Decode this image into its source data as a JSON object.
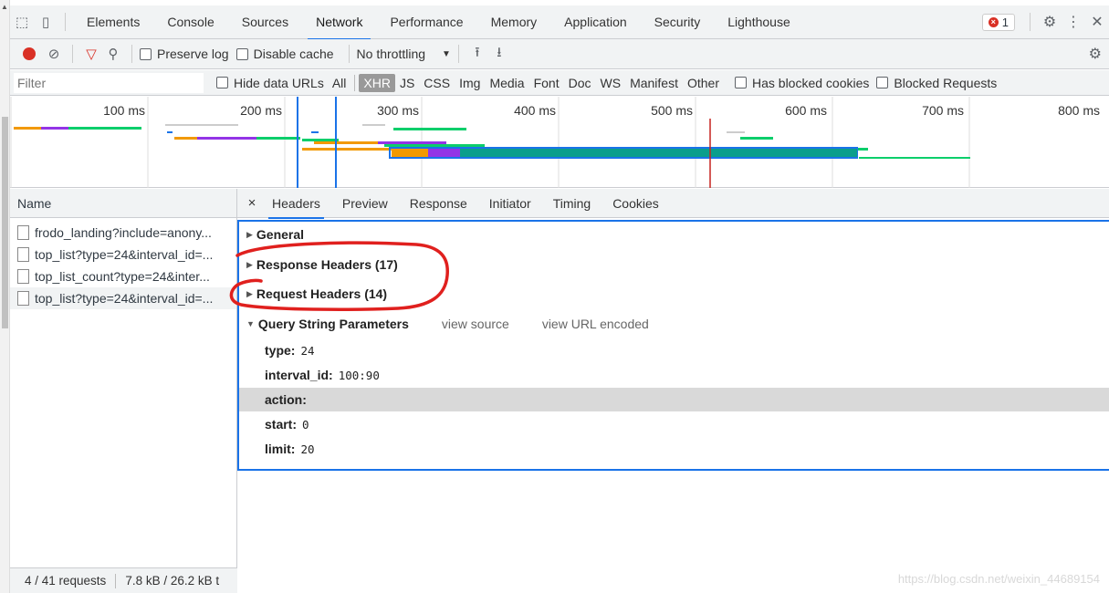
{
  "tabs": {
    "items": [
      "Elements",
      "Console",
      "Sources",
      "Network",
      "Performance",
      "Memory",
      "Application",
      "Security",
      "Lighthouse"
    ],
    "active": "Network",
    "error_count": "1"
  },
  "toolbar": {
    "preserve_log": "Preserve log",
    "disable_cache": "Disable cache",
    "throttling": "No throttling"
  },
  "filter": {
    "placeholder": "Filter",
    "hide_data_urls": "Hide data URLs",
    "types": [
      "All",
      "XHR",
      "JS",
      "CSS",
      "Img",
      "Media",
      "Font",
      "Doc",
      "WS",
      "Manifest",
      "Other"
    ],
    "active_type": "XHR",
    "has_blocked_cookies": "Has blocked cookies",
    "blocked_requests": "Blocked Requests"
  },
  "overview": {
    "ticks": [
      "100 ms",
      "200 ms",
      "300 ms",
      "400 ms",
      "500 ms",
      "600 ms",
      "700 ms",
      "800 ms"
    ]
  },
  "requests": {
    "header": "Name",
    "items": [
      "frodo_landing?include=anony...",
      "top_list?type=24&interval_id=...",
      "top_list_count?type=24&inter...",
      "top_list?type=24&interval_id=..."
    ],
    "selected_index": 3,
    "status_count": "4 / 41 requests",
    "status_size": "7.8 kB / 26.2 kB t"
  },
  "details": {
    "tabs": [
      "Headers",
      "Preview",
      "Response",
      "Initiator",
      "Timing",
      "Cookies"
    ],
    "active": "Headers",
    "general": "General",
    "response_headers": "Response Headers (17)",
    "request_headers": "Request Headers (14)",
    "query_params": "Query String Parameters",
    "view_source": "view source",
    "view_url_encoded": "view URL encoded",
    "params": [
      {
        "key": "type:",
        "value": "24"
      },
      {
        "key": "interval_id:",
        "value": "100:90"
      },
      {
        "key": "action:",
        "value": ""
      },
      {
        "key": "start:",
        "value": "0"
      },
      {
        "key": "limit:",
        "value": "20"
      }
    ]
  },
  "watermark": "https://blog.csdn.net/weixin_44689154",
  "colors": {
    "accent": "#1a73e8",
    "record": "#d93025",
    "annotation": "#e0201e"
  }
}
